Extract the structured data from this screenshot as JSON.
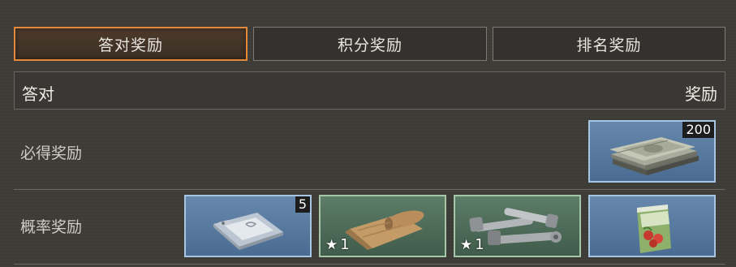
{
  "tabs": [
    {
      "label": "答对奖励",
      "active": true
    },
    {
      "label": "积分奖励",
      "active": false
    },
    {
      "label": "排名奖励",
      "active": false
    }
  ],
  "header": {
    "left": "答对",
    "right": "奖励"
  },
  "rows": [
    {
      "label": "必得奖励",
      "items": [
        {
          "icon": "money-stack-icon",
          "rarity": "blue",
          "count": "200"
        }
      ]
    },
    {
      "label": "概率奖励",
      "items": [
        {
          "icon": "plastic-bag-icon",
          "rarity": "blue",
          "count": "5"
        },
        {
          "icon": "cloth-roll-icon",
          "rarity": "green",
          "stars": "1"
        },
        {
          "icon": "bolts-icon",
          "rarity": "green",
          "stars": "1"
        },
        {
          "icon": "seed-pack-icon",
          "rarity": "blue"
        }
      ]
    }
  ]
}
